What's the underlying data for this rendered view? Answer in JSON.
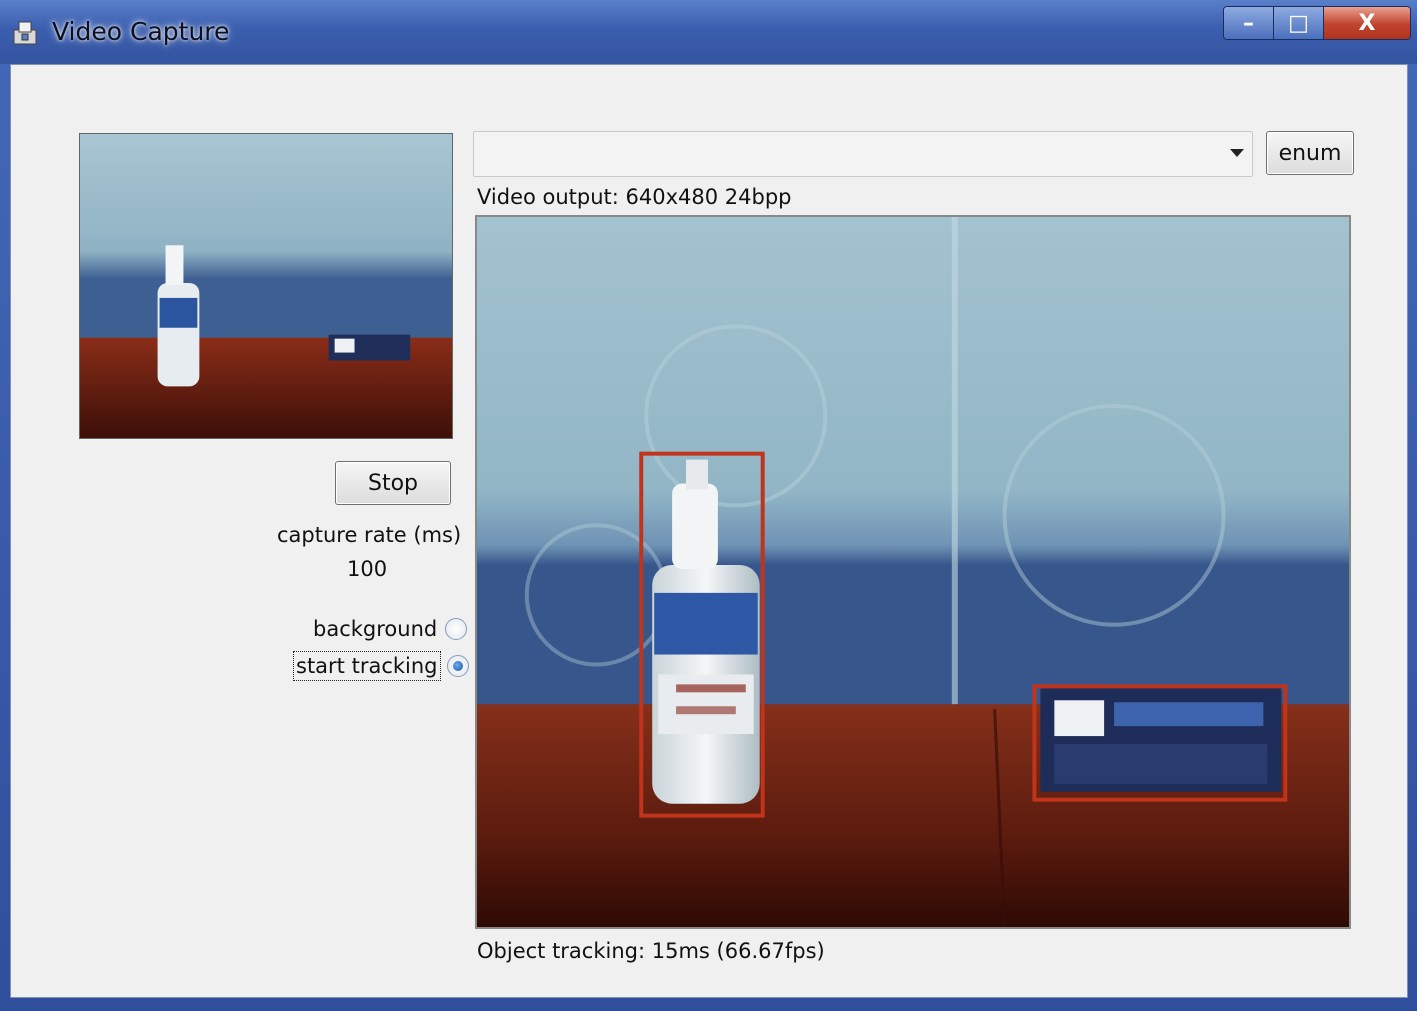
{
  "window": {
    "title": "Video Capture",
    "title_icon": "app-icon",
    "controls": {
      "minimize": "–",
      "maximize": "□",
      "close": "X"
    }
  },
  "device_selector": {
    "value": "",
    "options": []
  },
  "buttons": {
    "enum": "enum",
    "stop": "Stop"
  },
  "video_output_label": "Video output: 640x480 24bpp",
  "capture_rate": {
    "label": "capture rate (ms)",
    "value": "100"
  },
  "radios": {
    "background": {
      "label": "background",
      "checked": false
    },
    "start_tracking": {
      "label": "start tracking",
      "checked": true
    }
  },
  "object_tracking_label": "Object tracking: 15ms (66.67fps)",
  "tracked_objects": [
    {
      "label": "spray bottle"
    },
    {
      "label": "box"
    }
  ],
  "colors": {
    "title_bar": "#3b5eae",
    "client_bg": "#f0f0f0",
    "tracking_box": "#c0341c",
    "wall": "#8fb4c4",
    "table": "#7a2416"
  }
}
